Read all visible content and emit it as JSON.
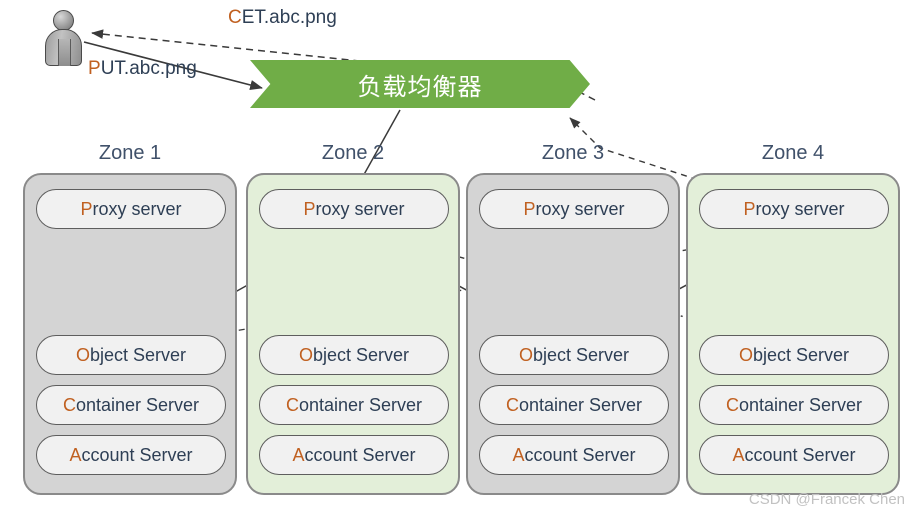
{
  "diagram": {
    "title": "OpenStack Swift zone architecture",
    "actor": {
      "name": "client-user"
    },
    "load_balancer": {
      "label": "负载均衡器"
    },
    "flows": [
      {
        "id": "get",
        "label": "CET.abc.png",
        "lead": "C",
        "rest": "ET.abc.png",
        "style": "dashed",
        "direction": "to-user"
      },
      {
        "id": "put",
        "label": "PUT.abc.png",
        "lead": "P",
        "rest": "UT.abc.png",
        "style": "solid",
        "direction": "to-balancer"
      }
    ],
    "zones": [
      {
        "title": "Zone 1",
        "fill": "gray",
        "nodes": [
          {
            "label": "Proxy server",
            "lead": "P",
            "rest": "roxy server"
          },
          {
            "label": "Object Server",
            "lead": "O",
            "rest": "bject Server"
          },
          {
            "label": "Container Server",
            "lead": "C",
            "rest": "ontainer Server"
          },
          {
            "label": "Account Server",
            "lead": "A",
            "rest": "ccount Server"
          }
        ]
      },
      {
        "title": "Zone 2",
        "fill": "green",
        "nodes": [
          {
            "label": "Proxy server",
            "lead": "P",
            "rest": "roxy server"
          },
          {
            "label": "Object Server",
            "lead": "O",
            "rest": "bject Server"
          },
          {
            "label": "Container Server",
            "lead": "C",
            "rest": "ontainer Server"
          },
          {
            "label": "Account Server",
            "lead": "A",
            "rest": "ccount Server"
          }
        ]
      },
      {
        "title": "Zone 3",
        "fill": "gray",
        "nodes": [
          {
            "label": "Proxy server",
            "lead": "P",
            "rest": "roxy server"
          },
          {
            "label": "Object Server",
            "lead": "O",
            "rest": "bject Server"
          },
          {
            "label": "Container Server",
            "lead": "C",
            "rest": "ontainer Server"
          },
          {
            "label": "Account Server",
            "lead": "A",
            "rest": "ccount Server"
          }
        ]
      },
      {
        "title": "Zone 4",
        "fill": "green",
        "nodes": [
          {
            "label": "Proxy server",
            "lead": "P",
            "rest": "roxy server"
          },
          {
            "label": "Object Server",
            "lead": "O",
            "rest": "bject Server"
          },
          {
            "label": "Container Server",
            "lead": "C",
            "rest": "ontainer Server"
          },
          {
            "label": "Account Server",
            "lead": "A",
            "rest": "ccount Server"
          }
        ]
      }
    ],
    "watermark": "CSDN @Francek Chen",
    "colors": {
      "banner_green": "#70ad47",
      "zone_gray": "#d4d4d4",
      "zone_green": "#e3efd9",
      "node_fill": "#f1f1f1",
      "text_navy": "#2e3f55",
      "text_accent": "#c06020",
      "edge": "#3a3a3a"
    }
  }
}
